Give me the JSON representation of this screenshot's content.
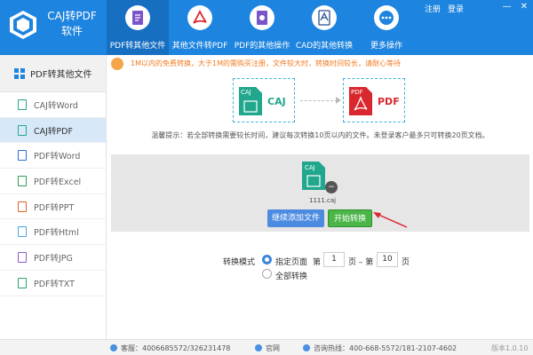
{
  "app": {
    "title": "CAJ转PDF软件"
  },
  "nav": [
    {
      "label": "PDF转其他文件",
      "icon": "pdf-convert-icon"
    },
    {
      "label": "其他文件转PDF",
      "icon": "acrobat-icon"
    },
    {
      "label": "PDF的其他操作",
      "icon": "pdf-tools-icon"
    },
    {
      "label": "CAD的其他转换",
      "icon": "cad-icon"
    },
    {
      "label": "更多操作",
      "icon": "more-icon"
    }
  ],
  "window": {
    "register": "注册",
    "login": "登录",
    "minimize": "—",
    "close": "✕"
  },
  "sidebar": {
    "header": "PDF转其他文件",
    "items": [
      {
        "label": "CAJ转Word"
      },
      {
        "label": "CAJ转PDF"
      },
      {
        "label": "PDF转Word"
      },
      {
        "label": "PDF转Excel"
      },
      {
        "label": "PDF转PPT"
      },
      {
        "label": "PDF转Html"
      },
      {
        "label": "PDF转JPG"
      },
      {
        "label": "PDF转TXT"
      }
    ]
  },
  "notice": {
    "text": "1M以内的免费转换，大于1M的需购买注册，文件较大时，转换时间较长，请耐心等待"
  },
  "flow": {
    "from_badge": "CAJ",
    "from_label": "CAJ",
    "to_badge": "PDF",
    "to_label": "PDF"
  },
  "tip": "温馨提示：若全部转换需要较长时间，建议每次转换10页以内的文件。未登录客户最多只可转换20页文档。",
  "file": {
    "badge": "CAJ",
    "name": "1111.caj"
  },
  "buttons": {
    "add": "继续添加文件",
    "start": "开始转换"
  },
  "mode": {
    "label": "转换模式",
    "specified": "指定页面",
    "page_from_prefix": "第",
    "page_from": "1",
    "page_mid": "页 – 第",
    "page_to": "10",
    "page_suffix": "页",
    "all": "全部转换"
  },
  "footer": {
    "support": "客服：4006685572/326231478",
    "website": "官网",
    "hotline": "咨询热线：400-668-5572/181-2107-4602",
    "version": "版本1.0.10"
  },
  "colors": {
    "primary": "#1d84df",
    "accent_orange": "#f07b21",
    "start_green": "#4bb548",
    "add_blue": "#4c8be0",
    "caj_teal": "#21a78e",
    "pdf_red": "#d9272e"
  }
}
